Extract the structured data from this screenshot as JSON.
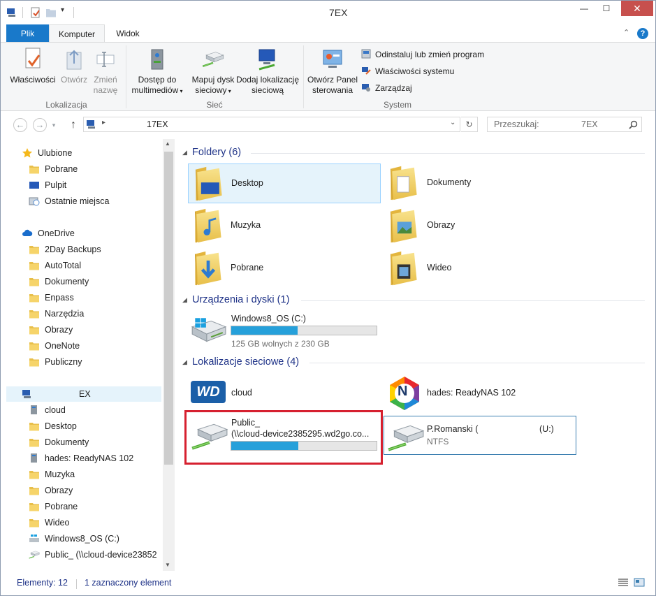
{
  "window": {
    "title": "7EX",
    "close_glyph": "✕",
    "minimize_glyph": "—",
    "maximize_glyph": "☐"
  },
  "ribbon_tabs": [
    "Plik",
    "Komputer",
    "Widok"
  ],
  "ribbon": {
    "location_group": {
      "label": "Lokalizacja",
      "buttons": [
        {
          "label": "Właściwości",
          "enabled": true
        },
        {
          "label": "Otwórz",
          "enabled": false
        },
        {
          "label_line1": "Zmień",
          "label_line2": "nazwę",
          "enabled": false
        }
      ]
    },
    "network_group": {
      "label": "Sieć",
      "buttons": [
        {
          "label_line1": "Dostęp do",
          "label_line2": "multimediów"
        },
        {
          "label_line1": "Mapuj dysk",
          "label_line2": "sieciowy"
        },
        {
          "label_line1": "Dodaj lokalizację",
          "label_line2": "sieciową"
        }
      ]
    },
    "system_group": {
      "label": "System",
      "big_button": {
        "label_line1": "Otwórz Panel",
        "label_line2": "sterowania"
      },
      "small_buttons": [
        "Odinstaluj lub zmień program",
        "Właściwości systemu",
        "Zarządzaj"
      ]
    }
  },
  "address": {
    "path": "17EX",
    "search_placeholder": "Przeszukaj:",
    "search_suffix": "7EX"
  },
  "nav_pane": {
    "favorites_header": "Ulubione",
    "favorites": [
      "Pobrane",
      "Pulpit",
      "Ostatnie miejsca"
    ],
    "onedrive_header": "OneDrive",
    "onedrive": [
      "2Day Backups",
      "AutoTotal",
      "Dokumenty",
      "Enpass",
      "Narzędzia",
      "Obrazy",
      "OneNote",
      "Publiczny"
    ],
    "computer_header": "EX",
    "computer": [
      "cloud",
      "Desktop",
      "Dokumenty",
      "hades: ReadyNAS 102",
      "Muzyka",
      "Obrazy",
      "Pobrane",
      "Wideo",
      "Windows8_OS (C:)",
      "Public_ (\\\\cloud-device23852"
    ]
  },
  "content": {
    "folders_header": "Foldery (6)",
    "folders": [
      "Desktop",
      "Dokumenty",
      "Muzyka",
      "Obrazy",
      "Pobrane",
      "Wideo"
    ],
    "devices_header": "Urządzenia i dyski (1)",
    "drive": {
      "name": "Windows8_OS (C:)",
      "space": "125 GB wolnych z 230 GB",
      "used_fraction": 0.457
    },
    "network_header": "Lokalizacje sieciowe (4)",
    "network": [
      {
        "name": "cloud"
      },
      {
        "name": "hades: ReadyNAS 102"
      },
      {
        "name_line1": "Public_",
        "name_line2": "(\\\\cloud-device2385295.wd2go.co...",
        "used_fraction": 0.46
      },
      {
        "name": "P.Romanski (",
        "drive_letter": "(U:)",
        "fs": "NTFS"
      }
    ],
    "wd_logo": "WD",
    "netgear_letter": "N"
  },
  "status": {
    "count": "Elementy: 12",
    "selected": "1 zaznaczony element"
  },
  "colors": {
    "accent": "#1979ca",
    "progress": "#26a0da",
    "header_text": "#1e3287",
    "selection_border": "#d6202f",
    "selected_bg": "#e5f3fb",
    "selected_border": "#99d1ff"
  }
}
